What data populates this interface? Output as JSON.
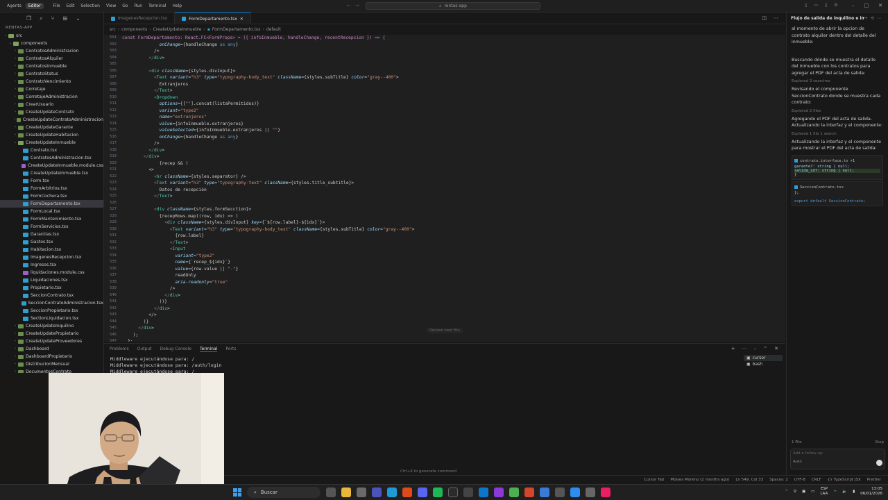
{
  "titlebar": {
    "modes": [
      "Agents",
      "Editor"
    ],
    "active_mode": "Editor",
    "menu": [
      "File",
      "Edit",
      "Selection",
      "View",
      "Go",
      "Run",
      "Terminal",
      "Help"
    ],
    "search_placeholder": "rentas-app"
  },
  "explorer": {
    "title": "RENTAS-APP",
    "items": [
      {
        "label": "src",
        "depth": 0,
        "kind": "folder-open",
        "expanded": true
      },
      {
        "label": "components",
        "depth": 1,
        "kind": "folder-open",
        "expanded": true
      },
      {
        "label": "ContratosAdministracion",
        "depth": 2,
        "kind": "folder"
      },
      {
        "label": "ContratosAlquiler",
        "depth": 2,
        "kind": "folder"
      },
      {
        "label": "ContratosInmueble",
        "depth": 2,
        "kind": "folder"
      },
      {
        "label": "ContratoStatus",
        "depth": 2,
        "kind": "folder"
      },
      {
        "label": "ContratoVencimiento",
        "depth": 2,
        "kind": "folder"
      },
      {
        "label": "Corretaje",
        "depth": 2,
        "kind": "folder"
      },
      {
        "label": "CorretajeAdministracion",
        "depth": 2,
        "kind": "folder"
      },
      {
        "label": "CrearUsuario",
        "depth": 2,
        "kind": "folder"
      },
      {
        "label": "CreateUpdateContrato",
        "depth": 2,
        "kind": "folder"
      },
      {
        "label": "CreateUpdateContratoAdministracion",
        "depth": 2,
        "kind": "folder"
      },
      {
        "label": "CreateUpdateGarante",
        "depth": 2,
        "kind": "folder"
      },
      {
        "label": "CreateUpdateHabitacion",
        "depth": 2,
        "kind": "folder"
      },
      {
        "label": "CreateUpdateInmueble",
        "depth": 2,
        "kind": "folder-open",
        "expanded": true
      },
      {
        "label": "Contrato.tsx",
        "depth": 3,
        "kind": "tsx"
      },
      {
        "label": "ContratosAdministracion.tsx",
        "depth": 3,
        "kind": "tsx"
      },
      {
        "label": "CreateUpdateInmueble.module.css",
        "depth": 3,
        "kind": "css"
      },
      {
        "label": "CreateUpdateInmueble.tsx",
        "depth": 3,
        "kind": "tsx"
      },
      {
        "label": "Form.tsx",
        "depth": 3,
        "kind": "tsx"
      },
      {
        "label": "FormArbitrios.tsx",
        "depth": 3,
        "kind": "tsx"
      },
      {
        "label": "FormCochera.tsx",
        "depth": 3,
        "kind": "tsx"
      },
      {
        "label": "FormDepartamento.tsx",
        "depth": 3,
        "kind": "tsx",
        "selected": true
      },
      {
        "label": "FormLocal.tsx",
        "depth": 3,
        "kind": "tsx"
      },
      {
        "label": "FormMantenimiento.tsx",
        "depth": 3,
        "kind": "tsx"
      },
      {
        "label": "FormServicios.tsx",
        "depth": 3,
        "kind": "tsx"
      },
      {
        "label": "Garantias.tsx",
        "depth": 3,
        "kind": "tsx"
      },
      {
        "label": "Gastos.tsx",
        "depth": 3,
        "kind": "tsx"
      },
      {
        "label": "Habitacion.tsx",
        "depth": 3,
        "kind": "tsx"
      },
      {
        "label": "ImagenesRecepcion.tsx",
        "depth": 3,
        "kind": "tsx"
      },
      {
        "label": "Ingresos.tsx",
        "depth": 3,
        "kind": "tsx"
      },
      {
        "label": "liquidaciones.module.css",
        "depth": 3,
        "kind": "css"
      },
      {
        "label": "Liquidaciones.tsx",
        "depth": 3,
        "kind": "tsx"
      },
      {
        "label": "Propietario.tsx",
        "depth": 3,
        "kind": "tsx"
      },
      {
        "label": "SeccionContrato.tsx",
        "depth": 3,
        "kind": "tsx"
      },
      {
        "label": "SeccionContratoAdministracion.tsx",
        "depth": 3,
        "kind": "tsx"
      },
      {
        "label": "SeccionPropietario.tsx",
        "depth": 3,
        "kind": "tsx"
      },
      {
        "label": "SectionLiquidacion.tsx",
        "depth": 3,
        "kind": "tsx"
      },
      {
        "label": "CreateUpdateInquilino",
        "depth": 2,
        "kind": "folder"
      },
      {
        "label": "CreateUpdatePropietario",
        "depth": 2,
        "kind": "folder"
      },
      {
        "label": "CreateUpdateProveedores",
        "depth": 2,
        "kind": "folder"
      },
      {
        "label": "Dashboard",
        "depth": 2,
        "kind": "folder"
      },
      {
        "label": "DashboardPropietario",
        "depth": 2,
        "kind": "folder"
      },
      {
        "label": "DistribucionMensual",
        "depth": 2,
        "kind": "folder"
      },
      {
        "label": "DocumentosContrato",
        "depth": 2,
        "kind": "folder"
      }
    ]
  },
  "tabs": [
    {
      "label": "ImagenesRecepcion.tsx",
      "active": false
    },
    {
      "label": "FormDepartamento.tsx",
      "active": true
    }
  ],
  "breadcrumb": [
    "src",
    "components",
    "CreateUpdateInmueble",
    "FormDepartamento.tsx",
    "default"
  ],
  "code": {
    "header": "const FormDepartamento: React.FC<FormProps> = ({ infoInmueble, handleChange, recentRecepcion }) => {",
    "lines": [
      {
        "n": "502",
        "indent": 6,
        "text": "onChange={handleChange as any}"
      },
      {
        "n": "503",
        "indent": 5,
        "text": "/>"
      },
      {
        "n": "504",
        "indent": 4,
        "text": "</div>"
      },
      {
        "n": "505",
        "indent": 0,
        "text": ""
      },
      {
        "n": "506",
        "indent": 4,
        "text": "<div className={styles.divInput}>"
      },
      {
        "n": "507",
        "indent": 5,
        "text": "<Text variant=\"h3\" type=\"typography-body_text\" className={styles.subTitle} color=\"gray--400\">"
      },
      {
        "n": "508",
        "indent": 6,
        "text": "Extranjeros"
      },
      {
        "n": "509",
        "indent": 5,
        "text": "</Text>"
      },
      {
        "n": "510",
        "indent": 5,
        "text": "<Dropdown"
      },
      {
        "n": "511",
        "indent": 6,
        "text": "options={[\"\"].concat(listaPermitidos)}"
      },
      {
        "n": "512",
        "indent": 6,
        "text": "variant=\"type2\""
      },
      {
        "n": "513",
        "indent": 6,
        "text": "name=\"extranjeros\""
      },
      {
        "n": "514",
        "indent": 6,
        "text": "value={infoInmueble.extranjeros}"
      },
      {
        "n": "515",
        "indent": 6,
        "text": "valueSelected={infoInmueble.extranjeros || \"\"}"
      },
      {
        "n": "516",
        "indent": 6,
        "text": "onChange={handleChange as any}"
      },
      {
        "n": "517",
        "indent": 5,
        "text": "/>"
      },
      {
        "n": "518",
        "indent": 4,
        "text": "</div>"
      },
      {
        "n": "519",
        "indent": 3,
        "text": "</div>"
      },
      {
        "n": "520",
        "indent": 6,
        "text": "{recep && ("
      },
      {
        "n": "521",
        "indent": 4,
        "text": "<>"
      },
      {
        "n": "522",
        "indent": 5,
        "text": "<hr className={styles.separator} />"
      },
      {
        "n": "523",
        "indent": 5,
        "text": "<Text variant=\"h3\" type=\"typography-text\" className={styles.title_subtitle}>"
      },
      {
        "n": "524",
        "indent": 6,
        "text": "Datos de recepción"
      },
      {
        "n": "525",
        "indent": 5,
        "text": "</Text>"
      },
      {
        "n": "526",
        "indent": 0,
        "text": ""
      },
      {
        "n": "527",
        "indent": 5,
        "text": "<div className={styles.formSecction}>"
      },
      {
        "n": "528",
        "indent": 6,
        "text": "{recepRows.map((row, idx) => ("
      },
      {
        "n": "529",
        "indent": 7,
        "text": "<div className={styles.divInput} key={`${row.label}-${idx}`}>"
      },
      {
        "n": "530",
        "indent": 8,
        "text": "<Text variant=\"h3\" type=\"typography-body_text\" className={styles.subTitle} color=\"gray--400\">"
      },
      {
        "n": "531",
        "indent": 9,
        "text": "{row.label}"
      },
      {
        "n": "532",
        "indent": 8,
        "text": "</Text>"
      },
      {
        "n": "533",
        "indent": 8,
        "text": "<Input"
      },
      {
        "n": "534",
        "indent": 9,
        "text": "variant=\"type2\""
      },
      {
        "n": "535",
        "indent": 9,
        "text": "name={`recep_${idx}`}"
      },
      {
        "n": "536",
        "indent": 9,
        "text": "value={row.value || \"-\"}"
      },
      {
        "n": "537",
        "indent": 9,
        "text": "readOnly"
      },
      {
        "n": "538",
        "indent": 9,
        "text": "aria-readonly=\"true\""
      },
      {
        "n": "539",
        "indent": 8,
        "text": "/>"
      },
      {
        "n": "540",
        "indent": 7,
        "text": "</div>"
      },
      {
        "n": "541",
        "indent": 6,
        "text": "))}"
      },
      {
        "n": "542",
        "indent": 5,
        "text": "</div>"
      },
      {
        "n": "543",
        "indent": 4,
        "text": "</>"
      },
      {
        "n": "544",
        "indent": 3,
        "text": ")}"
      },
      {
        "n": "545",
        "indent": 2,
        "text": "</div>"
      },
      {
        "n": "546",
        "indent": 1,
        "text": ");"
      },
      {
        "n": "547",
        "indent": 0,
        "text": "};"
      }
    ],
    "review_hint": "Review next file"
  },
  "panel": {
    "tabs": [
      "Problems",
      "Output",
      "Debug Console",
      "Terminal",
      "Ports"
    ],
    "active_tab": "Terminal",
    "terminal_lines": [
      "Middleware ejecutándose para: /",
      "Middleware ejecutándose para: /auth/login",
      "Middleware ejecutándose para: /"
    ],
    "terminals": [
      "cursor",
      "bash"
    ]
  },
  "chat": {
    "title": "Flujo de salida de inquilino e imágenes",
    "messages": [
      {
        "type": "text",
        "text": "al momento de abrir la opcion de contrato alquiler dentro del detalle del inmueble:"
      },
      {
        "type": "text",
        "text": "Buscando dónde se muestra el detalle del inmueble con los contratos para agregar el PDF del acta de salida:"
      },
      {
        "type": "sub",
        "text": "Explored 3 searches"
      },
      {
        "type": "text",
        "text": "Revisando el componente SeccionContrato donde se muestra cada contrato:"
      },
      {
        "type": "sub",
        "text": "Explored 2 files"
      },
      {
        "type": "text",
        "text": "Agregando el PDF del acta de salida. Actualizando la interfaz y el componente:"
      },
      {
        "type": "sub",
        "text": "Explored 1 file 1 search"
      },
      {
        "type": "text",
        "text": "Actualizando la interfaz y el componente para mostrar el PDF del acta de salida:"
      }
    ],
    "file1": {
      "name": "contrato.interface.ts",
      "delta": "+1"
    },
    "code1": [
      "garante?: string | null;",
      "salida_id?: string | null;",
      "}"
    ],
    "file2": {
      "name": "SeccionContrato.tsx"
    },
    "code2": [
      "};",
      "",
      "export default SeccionContrato;"
    ],
    "files_badge": "1 File",
    "stop_label": "Stop",
    "input_placeholder": "Add a follow-up",
    "mode_label": "Auto"
  },
  "command_hint": "Ctrl+K to generate command",
  "statusbar": [
    "Cursor Tab",
    "Moises Moreno (2 months ago)",
    "Ln 549, Col 33",
    "Spaces: 2",
    "UTF-8",
    "CRLF",
    "{} TypeScript JSX",
    "Prettier"
  ],
  "taskbar": {
    "search_label": "Buscar",
    "lang": "ESP",
    "lang2": "LAA",
    "time": "13:05",
    "date": "06/01/2026"
  }
}
